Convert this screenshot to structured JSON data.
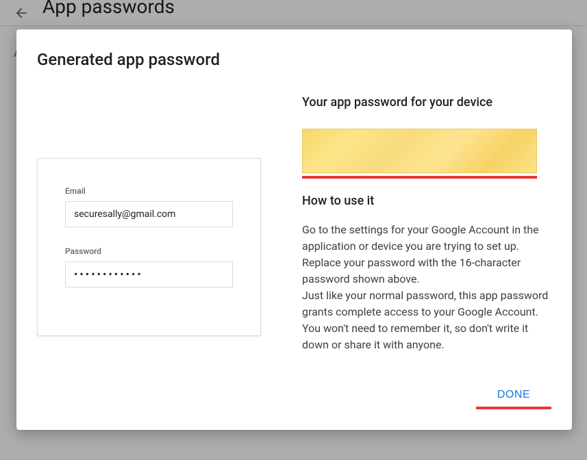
{
  "background": {
    "page_title": "App passwords",
    "body_snippet": "A\nV"
  },
  "dialog": {
    "title": "Generated app password",
    "form": {
      "email_label": "Email",
      "email_value": "securesally@gmail.com",
      "password_label": "Password",
      "password_value": "••••••••••••"
    },
    "right": {
      "device_heading": "Your app password for your device",
      "howto_heading": "How to use it",
      "instructions_p1": "Go to the settings for your Google Account in the application or device you are trying to set up. Replace your password with the 16-character password shown above.",
      "instructions_p2": "Just like your normal password, this app password grants complete access to your Google Account. You won't need to remember it, so don't write it down or share it with anyone."
    },
    "done_label": "DONE"
  }
}
